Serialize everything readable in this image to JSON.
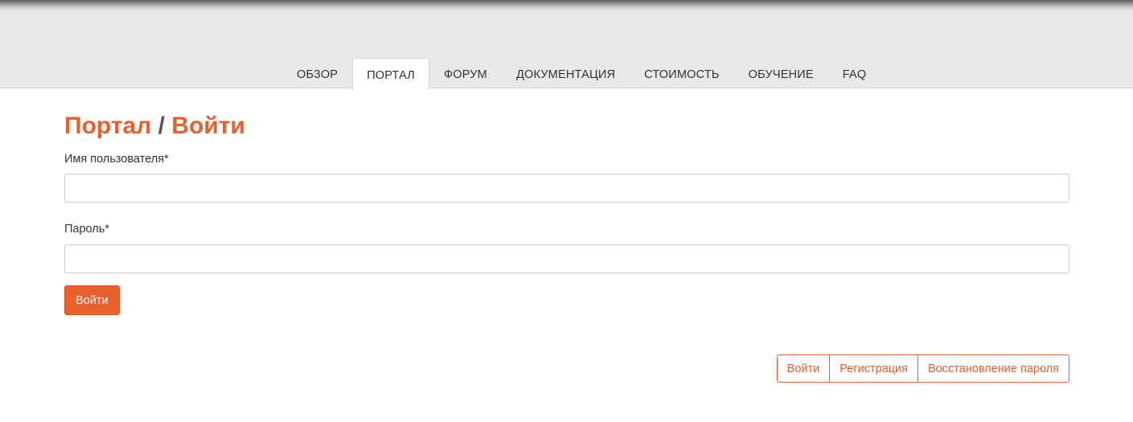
{
  "nav": {
    "tabs": [
      {
        "label": "ОБЗОР",
        "active": false
      },
      {
        "label": "ПОРТАЛ",
        "active": true
      },
      {
        "label": "ФОРУМ",
        "active": false
      },
      {
        "label": "ДОКУМЕНТАЦИЯ",
        "active": false
      },
      {
        "label": "СТОИМОСТЬ",
        "active": false
      },
      {
        "label": "ОБУЧЕНИЕ",
        "active": false
      },
      {
        "label": "FAQ",
        "active": false
      }
    ]
  },
  "page": {
    "title_section": "Портал",
    "title_separator": "/",
    "title_page": "Войти"
  },
  "form": {
    "username_label": "Имя пользователя*",
    "username_value": "",
    "password_label": "Пароль*",
    "password_value": "",
    "submit_label": "Войти"
  },
  "links": {
    "login": "Войти",
    "register": "Регистрация",
    "recover": "Восстановление пароля"
  },
  "colors": {
    "accent": "#e8602c",
    "header_bg": "#e8e8e8"
  }
}
